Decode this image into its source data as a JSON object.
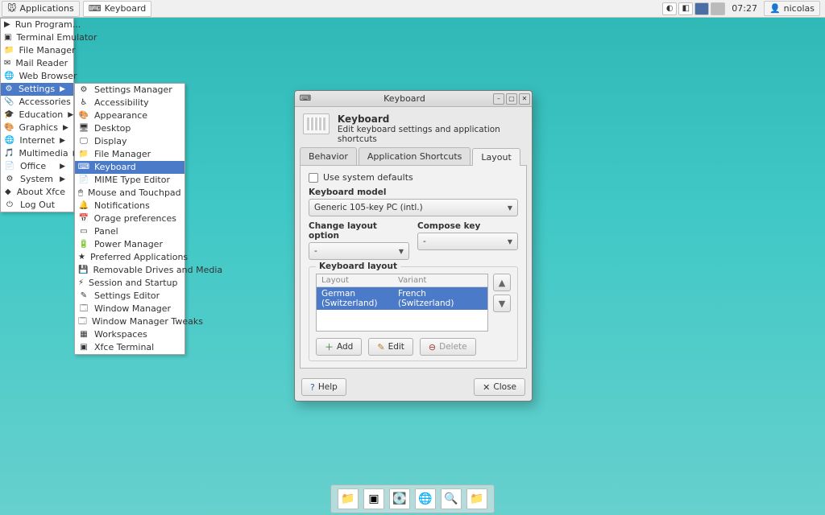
{
  "panel": {
    "app_menu": "Applications",
    "task": "Keyboard",
    "clock": "07:27",
    "user": "nicolas"
  },
  "menu1": [
    {
      "label": "Run Program...",
      "i": "▶"
    },
    {
      "label": "Terminal Emulator",
      "i": "▣"
    },
    {
      "label": "File Manager",
      "i": "📁"
    },
    {
      "label": "Mail Reader",
      "i": "✉"
    },
    {
      "label": "Web Browser",
      "i": "🌐"
    },
    {
      "label": "Settings",
      "i": "⚙",
      "sub": true,
      "hl": true
    },
    {
      "label": "Accessories",
      "i": "📎",
      "sub": true
    },
    {
      "label": "Education",
      "i": "🎓",
      "sub": true
    },
    {
      "label": "Graphics",
      "i": "🎨",
      "sub": true
    },
    {
      "label": "Internet",
      "i": "🌐",
      "sub": true
    },
    {
      "label": "Multimedia",
      "i": "🎵",
      "sub": true
    },
    {
      "label": "Office",
      "i": "📄",
      "sub": true
    },
    {
      "label": "System",
      "i": "⚙",
      "sub": true
    },
    {
      "label": "About Xfce",
      "i": "◆"
    },
    {
      "label": "Log Out",
      "i": "⏻"
    }
  ],
  "menu2": [
    {
      "label": "Settings Manager",
      "i": "⚙"
    },
    {
      "label": "Accessibility",
      "i": "♿"
    },
    {
      "label": "Appearance",
      "i": "🎨"
    },
    {
      "label": "Desktop",
      "i": "🖥"
    },
    {
      "label": "Display",
      "i": "🖵"
    },
    {
      "label": "File Manager",
      "i": "📁"
    },
    {
      "label": "Keyboard",
      "i": "⌨",
      "hl": true
    },
    {
      "label": "MIME Type Editor",
      "i": "📄"
    },
    {
      "label": "Mouse and Touchpad",
      "i": "🖱"
    },
    {
      "label": "Notifications",
      "i": "🔔"
    },
    {
      "label": "Orage preferences",
      "i": "📅"
    },
    {
      "label": "Panel",
      "i": "▭"
    },
    {
      "label": "Power Manager",
      "i": "🔋"
    },
    {
      "label": "Preferred Applications",
      "i": "★"
    },
    {
      "label": "Removable Drives and Media",
      "i": "💾"
    },
    {
      "label": "Session and Startup",
      "i": "⚡"
    },
    {
      "label": "Settings Editor",
      "i": "✎"
    },
    {
      "label": "Window Manager",
      "i": "🗔"
    },
    {
      "label": "Window Manager Tweaks",
      "i": "🗔"
    },
    {
      "label": "Workspaces",
      "i": "▦"
    },
    {
      "label": "Xfce Terminal",
      "i": "▣"
    }
  ],
  "window": {
    "title": "Keyboard",
    "head_title": "Keyboard",
    "head_sub": "Edit keyboard settings and application shortcuts",
    "tabs": [
      "Behavior",
      "Application Shortcuts",
      "Layout"
    ],
    "active_tab": 2,
    "use_defaults_label": "Use system defaults",
    "model_label": "Keyboard model",
    "model_value": "Generic 105-key PC (intl.)",
    "change_label": "Change layout option",
    "change_value": "-",
    "compose_label": "Compose key",
    "compose_value": "-",
    "layout_group": "Keyboard layout",
    "col_layout": "Layout",
    "col_variant": "Variant",
    "rows": [
      {
        "layout": "German (Switzerland)",
        "variant": "French (Switzerland)"
      }
    ],
    "btn_add": "Add",
    "btn_edit": "Edit",
    "btn_delete": "Delete",
    "btn_help": "Help",
    "btn_close": "Close"
  },
  "dock": [
    "📁",
    "▣",
    "💽",
    "🌐",
    "🔍",
    "📁"
  ]
}
